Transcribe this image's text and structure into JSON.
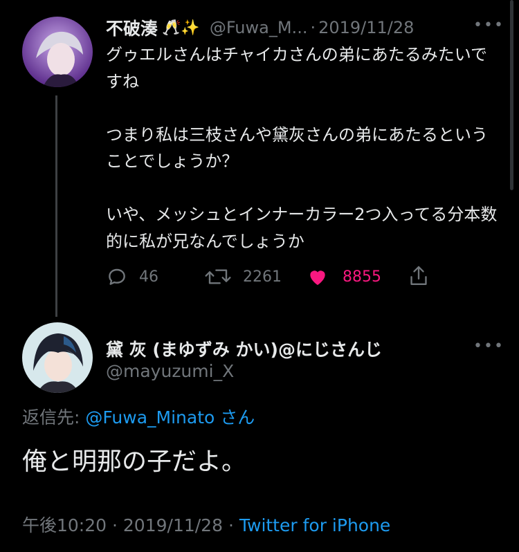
{
  "tweet1": {
    "name": "不破湊",
    "emoji": "🥂✨",
    "handle": "@Fuwa_M...",
    "separator": "·",
    "date": "2019/11/28",
    "more_icon": "ellipsis-icon",
    "body": "グゥエルさんはチャイカさんの弟にあたるみたいですね\n\nつまり私は三枝さんや黛灰さんの弟にあたるということでしょうか？\n\nいや、メッシュとインナーカラー2つ入ってる分本数的に私が兄なんでしょうか",
    "replies": "46",
    "retweets": "2261",
    "likes": "8855"
  },
  "tweet2": {
    "name": "黛 灰 (まゆずみ かい)@にじさんじ",
    "handle": "@mayuzumi_X",
    "reply_prefix": "返信先:",
    "reply_to": "@Fuwa_Minato",
    "reply_suffix": "さん",
    "body": "俺と明那の子だよ。",
    "time": "午後10:20",
    "sep1": "·",
    "date": "2019/11/28",
    "sep2": "·",
    "source": "Twitter for iPhone"
  },
  "colors": {
    "background": "#000000",
    "like": "#f91880",
    "link": "#1d9bf0",
    "muted": "#71767b"
  }
}
